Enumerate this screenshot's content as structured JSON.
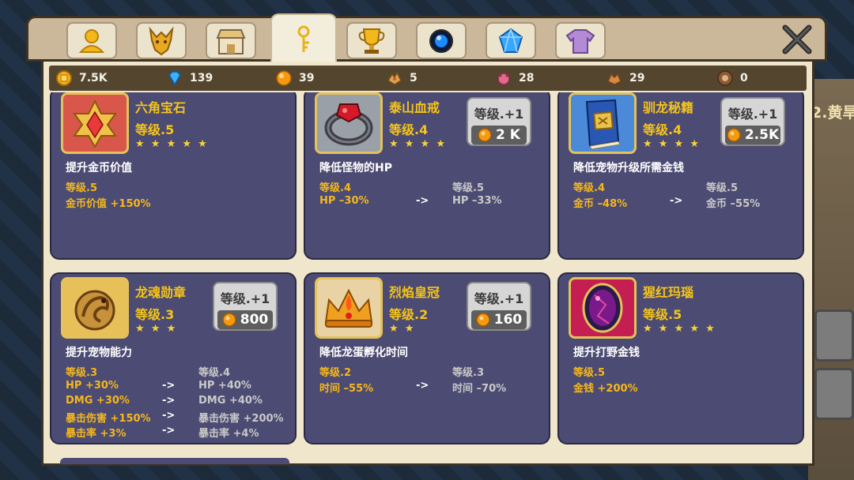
{
  "background": {
    "partial_text": "2.黄旱"
  },
  "tabs": [
    {
      "icon": "avatar-icon",
      "active": false
    },
    {
      "icon": "dragon-head-icon",
      "active": false
    },
    {
      "icon": "shop-icon",
      "active": false
    },
    {
      "icon": "relic-icon",
      "active": true
    },
    {
      "icon": "trophy-icon",
      "active": false
    },
    {
      "icon": "orb-icon",
      "active": false
    },
    {
      "icon": "diamond-icon",
      "active": false
    },
    {
      "icon": "shirt-icon",
      "active": false
    }
  ],
  "resources": [
    {
      "icon": "gold-coin-icon",
      "value": "7.5K"
    },
    {
      "icon": "blue-gem-icon",
      "value": "139"
    },
    {
      "icon": "orange-orb-icon",
      "value": "39"
    },
    {
      "icon": "pet-egg-icon",
      "value": "5"
    },
    {
      "icon": "monster-icon",
      "value": "28"
    },
    {
      "icon": "beast-icon",
      "value": "29"
    },
    {
      "icon": "egg-icon",
      "value": "0"
    }
  ],
  "relics": [
    {
      "name": "六角宝石",
      "level": "等级.5",
      "stars": "★ ★ ★ ★ ★",
      "description": "提升金币价值",
      "upgrade": null,
      "current_level": "等级.5",
      "next_level": "",
      "rows": [
        {
          "current": "金币价值 +150%",
          "arrow": "",
          "next": ""
        }
      ]
    },
    {
      "name": "泰山血戒",
      "level": "等级.4",
      "stars": "★ ★ ★ ★",
      "description": "降低怪物的HP",
      "upgrade": {
        "label": "等级.+1",
        "cost": "2 K"
      },
      "current_level": "等级.4",
      "next_level": "等级.5",
      "rows": [
        {
          "current": "HP –30%",
          "arrow": "->",
          "next": "HP –33%"
        }
      ]
    },
    {
      "name": "驯龙秘籍",
      "level": "等级.4",
      "stars": "★ ★ ★ ★",
      "description": "降低宠物升级所需金钱",
      "upgrade": {
        "label": "等级.+1",
        "cost": "2.5K"
      },
      "current_level": "等级.4",
      "next_level": "等级.5",
      "rows": [
        {
          "current": "金币 –48%",
          "arrow": "->",
          "next": "金币 –55%"
        }
      ]
    },
    {
      "name": "龙魂勋章",
      "level": "等级.3",
      "stars": "★ ★ ★",
      "description": "提升宠物能力",
      "upgrade": {
        "label": "等级.+1",
        "cost": "800"
      },
      "current_level": "等级.3",
      "next_level": "等级.4",
      "rows": [
        {
          "current": "HP +30%",
          "arrow": "->",
          "next": "HP +40%"
        },
        {
          "current": "DMG +30%",
          "arrow": "->",
          "next": "DMG +40%"
        },
        {
          "current": "暴击伤害 +150%",
          "arrow": "->",
          "next": "暴击伤害 +200%"
        },
        {
          "current": "暴击率 +3%",
          "arrow": "->",
          "next": "暴击率 +4%"
        }
      ]
    },
    {
      "name": "烈焰皇冠",
      "level": "等级.2",
      "stars": "★ ★",
      "description": "降低龙蛋孵化时间",
      "upgrade": {
        "label": "等级.+1",
        "cost": "160"
      },
      "current_level": "等级.2",
      "next_level": "等级.3",
      "rows": [
        {
          "current": "时间 –55%",
          "arrow": "->",
          "next": "时间 –70%"
        }
      ]
    },
    {
      "name": "猩红玛瑙",
      "level": "等级.5",
      "stars": "★ ★ ★ ★ ★",
      "description": "提升打野金钱",
      "upgrade": null,
      "current_level": "等级.5",
      "next_level": "",
      "rows": [
        {
          "current": "金钱 +200%",
          "arrow": "",
          "next": ""
        }
      ]
    }
  ],
  "colors": {
    "card_bg": "#4c4b73",
    "gold_text": "#f5c518",
    "panel_bg": "#efe6cc",
    "resource_bar": "#54462e"
  }
}
